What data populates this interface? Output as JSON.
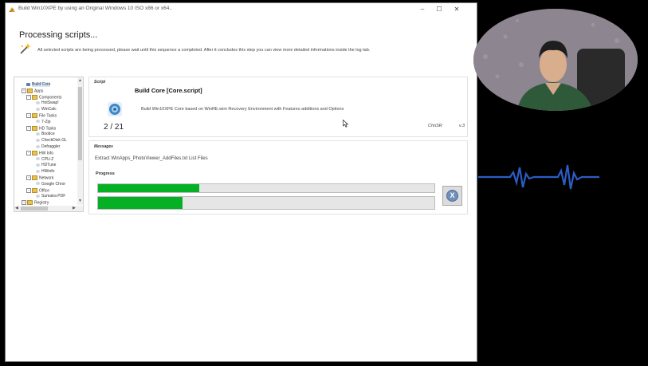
{
  "window": {
    "title": "Build Win10XPE by using an Original Windows 10 ISO x86 or x64..",
    "minimize": "–",
    "maximize": "☐",
    "close": "✕"
  },
  "header": {
    "heading": "Processing scripts...",
    "description": "All selected scripts are being processed, please wait until this sequence a completed. After it concludes this step you can view more detailed informations inside the log tab."
  },
  "tree": {
    "nodes": [
      {
        "label": "Build Core",
        "kind": "gear",
        "selected": true
      },
      {
        "label": "Apps",
        "kind": "folder",
        "expander": "−"
      },
      {
        "label": "Components",
        "kind": "folder",
        "expander": "−"
      },
      {
        "label": "HotSwap!",
        "kind": "item"
      },
      {
        "label": "WinCalc",
        "kind": "item"
      },
      {
        "label": "File Tasks",
        "kind": "folder",
        "expander": "−"
      },
      {
        "label": "7-Zip",
        "kind": "item"
      },
      {
        "label": "HD Tasks",
        "kind": "folder",
        "expander": "−"
      },
      {
        "label": "Bootice",
        "kind": "item"
      },
      {
        "label": "CheckDisk GL",
        "kind": "item"
      },
      {
        "label": "Defraggler",
        "kind": "item"
      },
      {
        "label": "HW Info",
        "kind": "folder",
        "expander": "−"
      },
      {
        "label": "CPU-Z",
        "kind": "item"
      },
      {
        "label": "HDTune",
        "kind": "item"
      },
      {
        "label": "HWinfo",
        "kind": "item"
      },
      {
        "label": "Network",
        "kind": "folder",
        "expander": "−"
      },
      {
        "label": "Google Chror",
        "kind": "item"
      },
      {
        "label": "Office",
        "kind": "folder",
        "expander": "−"
      },
      {
        "label": "Sumatra PDF",
        "kind": "item"
      },
      {
        "label": "Registry",
        "kind": "folder",
        "expander": "+"
      }
    ]
  },
  "script": {
    "section_label": "Script",
    "title": "Build Core [Core.script]",
    "description": "Build Win10XPE Core based on WinRE.wim Recovery Environment with Features additions and Options",
    "counter": "2 / 21",
    "author": "ChriSR",
    "version": "v.3",
    "icon": "gear-script-icon"
  },
  "messages": {
    "section_label": "Messages",
    "text": "Extract WinApps_PhotoViewer_AddFiles.txt List Files",
    "progress_label": "Progress",
    "progress_script": 0.3,
    "progress_total": 0.25,
    "cancel_glyph": "X",
    "progress_color": "#06b025"
  }
}
